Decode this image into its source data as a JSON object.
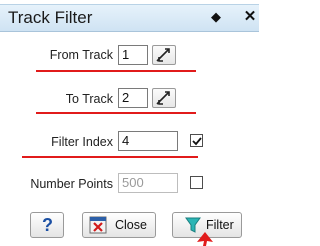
{
  "window": {
    "title": "Track Filter",
    "pin_glyph": "◆",
    "close_glyph": "✕"
  },
  "form": {
    "from_track": {
      "label": "From Track",
      "value": "1"
    },
    "to_track": {
      "label": "To Track",
      "value": "2"
    },
    "filter_index": {
      "label": "Filter Index",
      "value": "4",
      "checked": true
    },
    "number_points": {
      "label": "Number Points",
      "value": "500",
      "checked": false,
      "disabled": true
    }
  },
  "buttons": {
    "help": "?",
    "close": "Close",
    "filter": "Filter"
  },
  "colors": {
    "annotation_red": "#e11b1b",
    "titlebar": "#d7e9f7"
  },
  "icons": [
    "spinner-icon",
    "checkmark-icon",
    "help-icon",
    "close-icon",
    "filter-icon",
    "cursor-arrow-icon"
  ]
}
